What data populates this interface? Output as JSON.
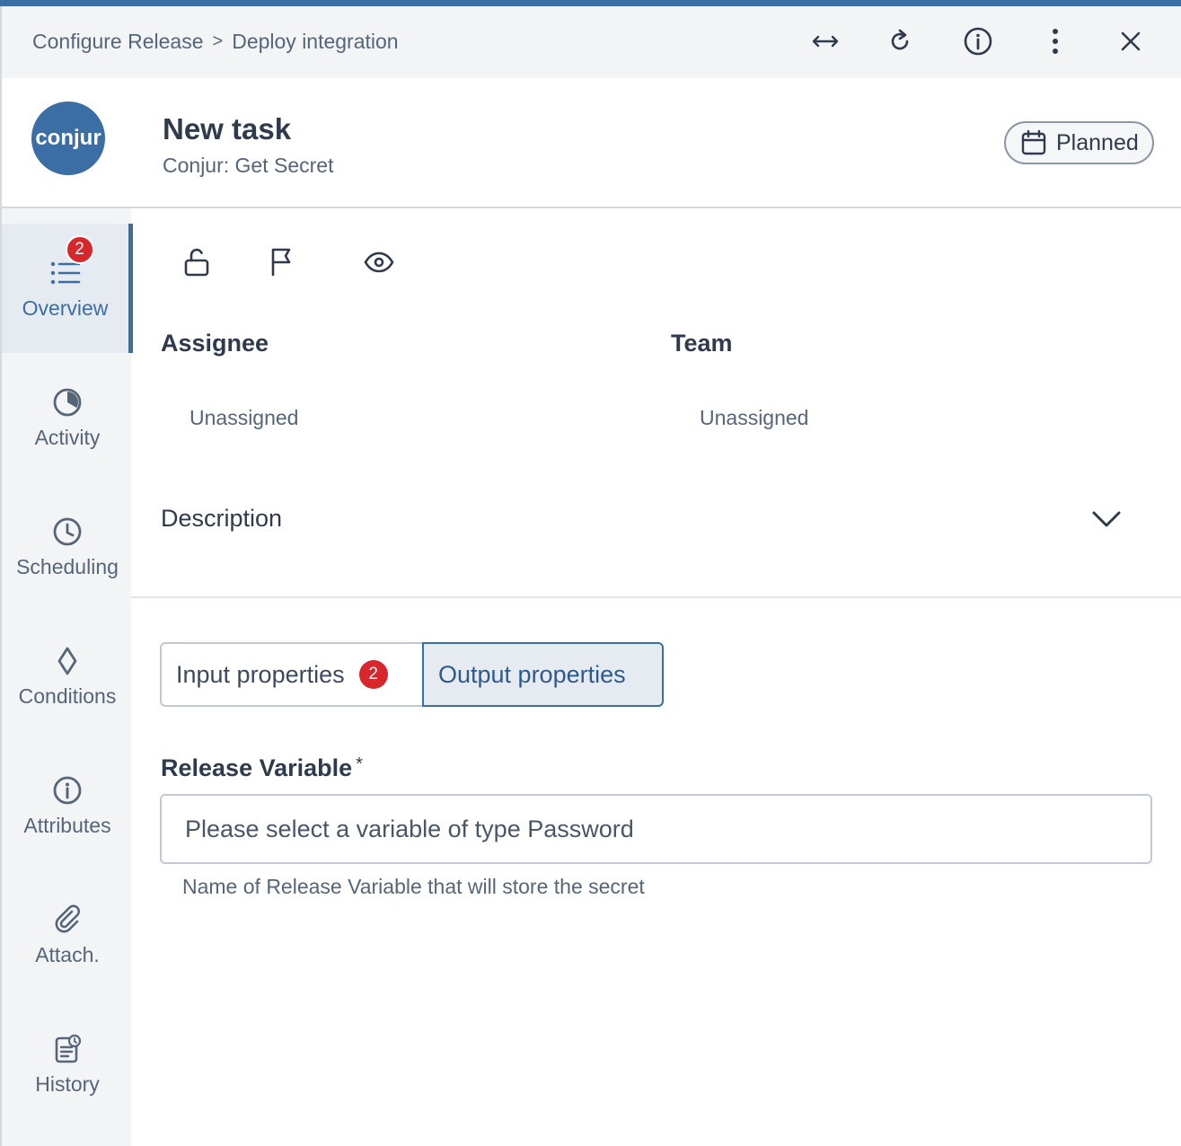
{
  "header": {
    "breadcrumb": [
      "Configure Release",
      "Deploy integration"
    ],
    "breadcrumb_separator": ">",
    "icons": [
      "expand-horizontal-icon",
      "refresh-icon",
      "info-icon",
      "more-vertical-icon",
      "close-icon"
    ]
  },
  "task": {
    "logo_text": "conjur",
    "title": "New task",
    "subtitle": "Conjur: Get Secret",
    "status": "Planned"
  },
  "sidebar": {
    "items": [
      {
        "label": "Overview",
        "icon": "list-icon",
        "badge": "2",
        "active": true
      },
      {
        "label": "Activity",
        "icon": "activity-icon"
      },
      {
        "label": "Scheduling",
        "icon": "clock-icon"
      },
      {
        "label": "Conditions",
        "icon": "diamond-icon"
      },
      {
        "label": "Attributes",
        "icon": "info-icon"
      },
      {
        "label": "Attach.",
        "icon": "paperclip-icon"
      },
      {
        "label": "History",
        "icon": "history-icon"
      }
    ]
  },
  "overview": {
    "toolbar_icons": [
      "unlock-icon",
      "flag-icon",
      "eye-icon"
    ],
    "assignee_label": "Assignee",
    "assignee_value": "Unassigned",
    "team_label": "Team",
    "team_value": "Unassigned",
    "description_label": "Description"
  },
  "tabs": [
    {
      "label": "Input properties",
      "badge": "2",
      "active": false
    },
    {
      "label": "Output properties",
      "active": true
    }
  ],
  "field": {
    "label": "Release Variable",
    "required_mark": "*",
    "placeholder": "Please select a variable of type Password",
    "help": "Name of Release Variable that will store the secret"
  },
  "colors": {
    "accent": "#3b6ea5",
    "badge": "#d9262c",
    "sidebar_bg": "#f3f4f6"
  }
}
